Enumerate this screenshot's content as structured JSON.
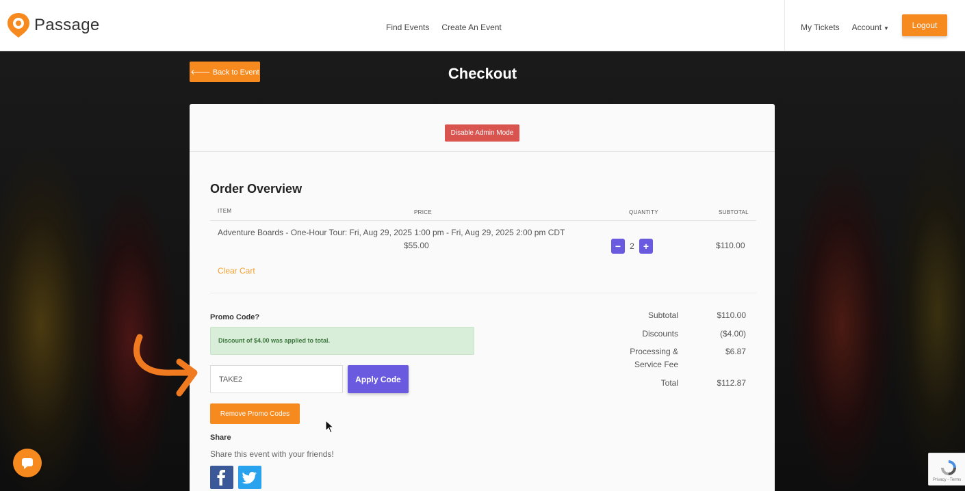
{
  "header": {
    "brand": "Passage",
    "nav_center": [
      "Find Events",
      "Create An Event"
    ],
    "nav_right": {
      "my_tickets": "My Tickets",
      "account": "Account"
    },
    "logout_label": "Logout"
  },
  "page": {
    "back_label": "Back to Event",
    "title": "Checkout"
  },
  "card": {
    "admin_button": "Disable Admin Mode",
    "section_title": "Order Overview",
    "columns": {
      "item": "ITEM",
      "price": "PRICE",
      "quantity": "QUANTITY",
      "subtotal": "SUBTOTAL"
    },
    "item": {
      "name": "Adventure Boards - One-Hour Tour: Fri, Aug 29, 2025 1:00 pm - Fri, Aug 29, 2025 2:00 pm CDT",
      "price": "$55.00",
      "quantity": "2",
      "subtotal": "$110.00"
    },
    "clear_cart": "Clear Cart",
    "promo": {
      "label": "Promo Code?",
      "alert": "Discount of $4.00 was applied to total.",
      "input_value": "TAKE2",
      "apply_label": "Apply Code",
      "remove_label": "Remove Promo Codes"
    },
    "share": {
      "title": "Share",
      "text": "Share this event with your friends!"
    },
    "summary": {
      "subtotal_label": "Subtotal",
      "subtotal_value": "$110.00",
      "discounts_label": "Discounts",
      "discounts_value": "($4.00)",
      "fee_label_1": "Processing &",
      "fee_label_2": "Service Fee",
      "fee_value": "$6.87",
      "total_label": "Total",
      "total_value": "$112.87"
    }
  },
  "recaptcha": {
    "text": "Privacy - Terms"
  },
  "colors": {
    "accent_orange": "#f78a1f",
    "purple": "#6a5ae0",
    "danger": "#d9534f"
  },
  "icons": [
    "passage-logo-icon",
    "arrow-left-icon",
    "minus-icon",
    "plus-icon",
    "facebook-icon",
    "twitter-icon",
    "chat-icon",
    "recaptcha-icon",
    "mouse-cursor-icon"
  ]
}
